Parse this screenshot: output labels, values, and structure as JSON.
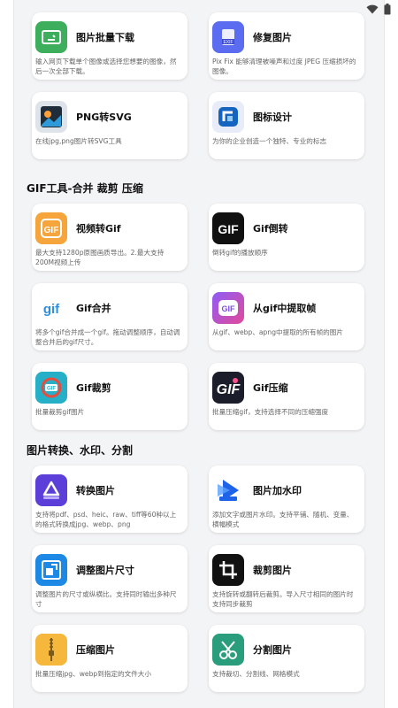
{
  "colors": {
    "accent": "#1e88e5",
    "background": "#f3f4f6",
    "card": "#ffffff",
    "desc": "#666666"
  },
  "group_top": [
    {
      "icon": "image-download-icon",
      "title": "图片批量下载",
      "desc": "输入网页下载单个图像或选择您想要的图像，然后一次全部下载。"
    },
    {
      "icon": "exif-repair-icon",
      "title": "修复图片",
      "desc": "Pix Fix 能够清理被噪声和过度 JPEG 压缩损坏的图像。"
    },
    {
      "icon": "png-svg-icon",
      "title": "PNG转SVG",
      "desc": "在线jpg,png图片转SVG工具"
    },
    {
      "icon": "logo-design-icon",
      "title": "图标设计",
      "desc": "为你的企业创造一个独特、专业的标志"
    }
  ],
  "section_gif": {
    "title": "GIF工具-合并 裁剪 压缩"
  },
  "group_gif": [
    {
      "icon": "video-to-gif-icon",
      "title": "视频转Gif",
      "desc": "最大支持1280p原图画质导出。2.最大支持200M视频上传"
    },
    {
      "icon": "gif-reverse-icon",
      "title": "Gif倒转",
      "desc": "倒转gif的播放顺序"
    },
    {
      "icon": "gif-merge-icon",
      "title": "Gif合并",
      "desc": "将多个gif合并成一个gif。拖动调整顺序，自动调整合并后的gif尺寸。"
    },
    {
      "icon": "gif-extract-frames-icon",
      "title": "从gif中提取帧",
      "desc": "从gif、webp、apng中提取的所有帧的图片"
    },
    {
      "icon": "gif-crop-icon",
      "title": "Gif裁剪",
      "desc": "批量裁剪gif图片"
    },
    {
      "icon": "gif-compress-icon",
      "title": "Gif压缩",
      "desc": "批量压缩gif，支持选择不同的压缩强度"
    }
  ],
  "section_convert": {
    "title": "图片转换、水印、分割"
  },
  "group_convert": [
    {
      "icon": "convert-image-icon",
      "title": "转换图片",
      "desc": "支持将pdf、psd、heic、raw、tiff等60种以上的格式转换成jpg、webp、png"
    },
    {
      "icon": "watermark-icon",
      "title": "图片加水印",
      "desc": "添加文字或图片水印。支持平铺、随机、变量、横幅模式"
    },
    {
      "icon": "resize-icon",
      "title": "调整图片尺寸",
      "desc": "调整图片的尺寸或纵横比。支持同时输出多种尺寸"
    },
    {
      "icon": "crop-icon",
      "title": "裁剪图片",
      "desc": "支持旋转或翻转后裁剪。导入尺寸相同的图片时支持同步裁剪"
    },
    {
      "icon": "compress-image-icon",
      "title": "压缩图片",
      "desc": "批量压缩jpg、webp到指定的文件大小"
    },
    {
      "icon": "split-image-icon",
      "title": "分割图片",
      "desc": "支持裁切、分割线、网格模式"
    }
  ]
}
